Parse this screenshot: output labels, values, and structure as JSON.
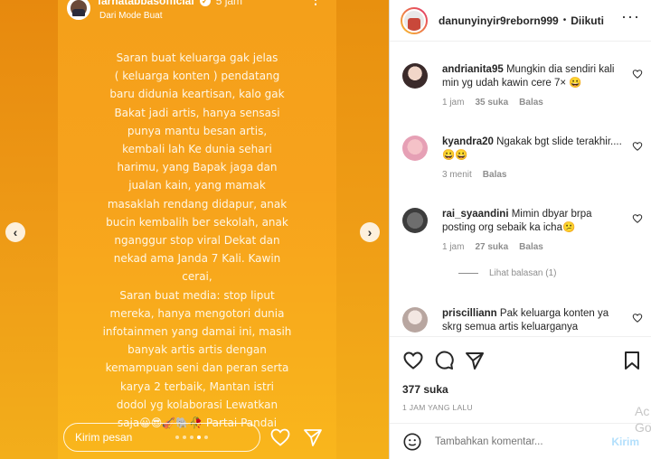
{
  "story": {
    "username": "farhatabbasofficial",
    "time": "5 jam",
    "subtitle": "Dari Mode Buat",
    "text_lines": [
      "Saran buat keluarga gak jelas",
      "( keluarga konten ) pendatang",
      "baru didunia keartisan, kalo gak",
      "Bakat jadi artis, hanya sensasi",
      "punya mantu besan artis,",
      "kembali lah Ke dunia sehari",
      "harimu, yang Bapak jaga dan",
      "jualan kain, yang mamak",
      "masaklah rendang didapur, anak",
      "bucin kembalih ber sekolah, anak",
      "nganggur stop viral Dekat dan",
      "nekad ama Janda 7 Kali. Kawin",
      "cerai,",
      "Saran buat media: stop liput",
      "mereka, hanya mengotori dunia",
      "infotainmen yang damai ini, masih",
      "banyak artis artis dengan",
      "kemampuan seni dan peran serta",
      "karya 2 terbaik, Mantan istri",
      "dodol yg kolaborasi Lewatkan",
      "saja😀😎🎻🐘🥀 Partai Pandai"
    ],
    "reply_placeholder": "Kirim pesan",
    "dots_count": 5,
    "active_dot": 3
  },
  "post": {
    "username": "danunyinyir9reborn999",
    "follow_label": "Diikuti",
    "likes": "377 suka",
    "time": "1 JAM YANG LALU",
    "comment_placeholder": "Tambahkan komentar...",
    "post_label": "Kirim",
    "watermark": "Ac\nGo"
  },
  "comments": [
    {
      "user": "andrianita95",
      "text": "Mungkin dia sendiri kali min yg udah kawin cere 7× 😀",
      "time": "1 jam",
      "likes": "35 suka",
      "reply": "Balas"
    },
    {
      "user": "kyandra20",
      "text": "Ngakak bgt slide terakhir....😀😀",
      "time": "3 menit",
      "likes": "",
      "reply": "Balas"
    },
    {
      "user": "rai_syaandini",
      "text": "Mimin dbyar brpa posting org sebaik ka icha😕",
      "time": "1 jam",
      "likes": "27 suka",
      "reply": "Balas",
      "view_replies": "Lihat balasan (1)"
    },
    {
      "user": "priscilliann",
      "text": "Pak keluarga konten ya skrg semua artis keluarganya",
      "time": "",
      "likes": "",
      "reply": ""
    }
  ],
  "colors": {
    "story_orange": "#f7a21c",
    "link_blue": "#b2dffc",
    "text_dark": "#262626",
    "muted": "#8e8e8e"
  }
}
